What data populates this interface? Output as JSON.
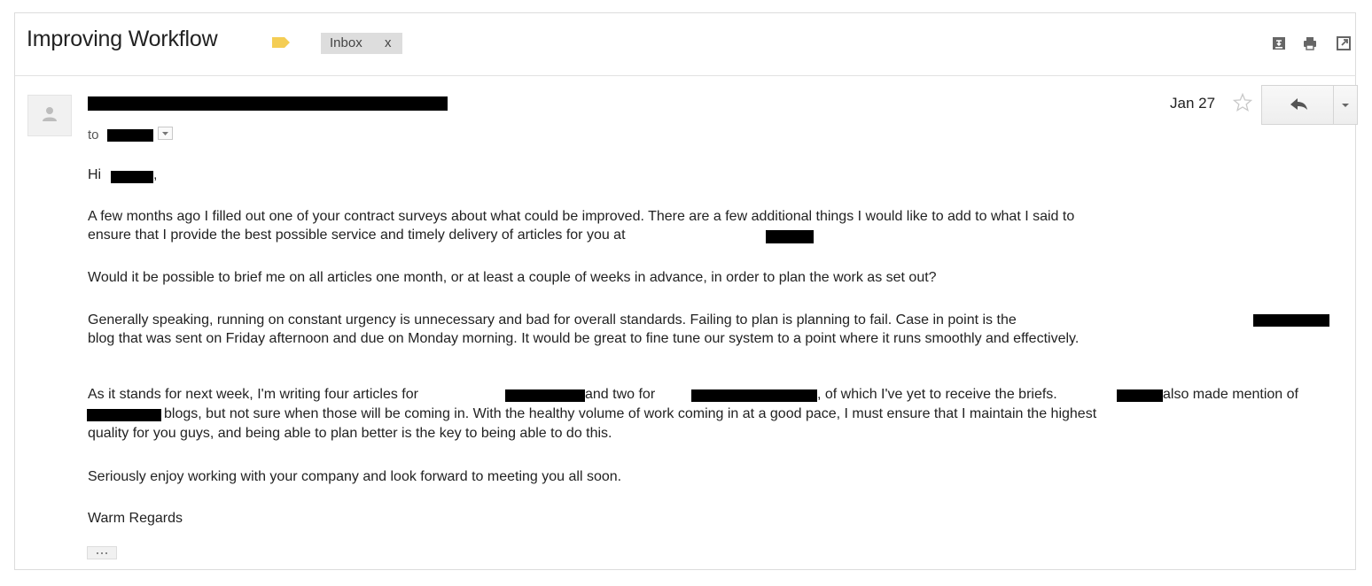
{
  "thread": {
    "subject": "Improving Workflow",
    "label_color": "#f4cd54",
    "chip": {
      "label": "Inbox",
      "remove": "x"
    },
    "toolbar_icons": [
      "print-all-icon",
      "print-icon",
      "new-window-icon"
    ]
  },
  "message": {
    "to_prefix": "to",
    "date": "Jan 27",
    "body": {
      "greeting_prefix": "Hi",
      "greeting_suffix": ",",
      "p1_line1": "A few months ago I filled out one of your contract surveys about what could be improved. There are a few additional things I would like to add to what I said to",
      "p1_line2": "ensure that I provide the best possible service and timely delivery of articles for you at",
      "p2_line1": "Would it be possible to brief me on all articles one month, or at least a couple of weeks in advance, in order to plan the work as set out?",
      "p3_line1": "Generally speaking, running on constant urgency is unnecessary and bad for overall standards. Failing to plan is planning to fail. Case in point is the",
      "p3_line2": "blog that was sent on Friday afternoon and due on Monday morning. It would be great to fine tune our system to a point where it runs smoothly and effectively.",
      "p4_line1_a": "As it stands for next week, I'm writing four articles for",
      "p4_line1_b": "and two for",
      "p4_line1_c": ", of which I've yet to receive the briefs.",
      "p4_line1_d": "also made mention of",
      "p4_line2": "blogs, but not sure when those will be coming in. With the healthy volume of work coming in at a good pace, I must ensure that I maintain the highest",
      "p4_line3": "quality for you guys, and being able to plan better is the key to being able to do this.",
      "p5_line1": "Seriously enjoy working with your company and look forward to meeting you all soon.",
      "signoff": "Warm Regards"
    }
  }
}
